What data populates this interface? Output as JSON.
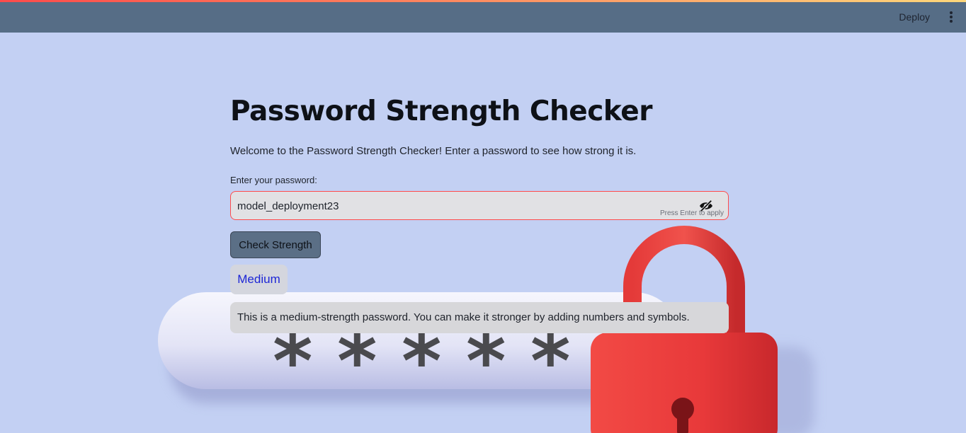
{
  "header": {
    "deploy_label": "Deploy",
    "menu_icon": "kebab-menu-icon"
  },
  "main": {
    "title": "Password Strength Checker",
    "intro": "Welcome to the Password Strength Checker! Enter a password to see how strong it is.",
    "password_label": "Enter your password:",
    "password_value": "model_deployment23",
    "visibility_icon": "eye-off-icon",
    "input_hint": "Press Enter to apply",
    "check_button_label": "Check Strength",
    "strength_level": "Medium",
    "strength_message": "This is a medium-strength password. You can make it stronger by adding numbers and symbols."
  },
  "colors": {
    "background": "#c3d0f3",
    "header": "#566d86",
    "input_border": "#ff4b4b",
    "button": "#5b6f86",
    "strength_text": "#1d26d6",
    "lock": "#e8393a"
  }
}
